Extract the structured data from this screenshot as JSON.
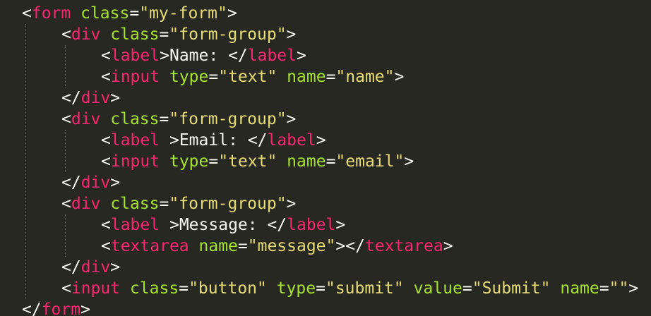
{
  "editor": {
    "colors": {
      "background": "#272822",
      "tag": "#f92672",
      "attribute": "#a6e22e",
      "string": "#e6db74",
      "text": "#f8f8f2",
      "indent_guide": "#5a5a52"
    },
    "lines": [
      {
        "tokens": [
          [
            "punc",
            "<"
          ],
          [
            "tag",
            "form"
          ],
          [
            "text",
            " "
          ],
          [
            "attr",
            "class"
          ],
          [
            "punc",
            "="
          ],
          [
            "str",
            "\"my-form\""
          ],
          [
            "punc",
            ">"
          ]
        ]
      },
      {
        "tokens": [
          [
            "punc",
            "<"
          ],
          [
            "tag",
            "div"
          ],
          [
            "text",
            " "
          ],
          [
            "attr",
            "class"
          ],
          [
            "punc",
            "="
          ],
          [
            "str",
            "\"form-group\""
          ],
          [
            "punc",
            ">"
          ]
        ]
      },
      {
        "tokens": [
          [
            "punc",
            "<"
          ],
          [
            "tag",
            "label"
          ],
          [
            "punc",
            ">"
          ],
          [
            "text",
            "Name: "
          ],
          [
            "punc",
            "</"
          ],
          [
            "tag",
            "label"
          ],
          [
            "punc",
            ">"
          ]
        ]
      },
      {
        "tokens": [
          [
            "punc",
            "<"
          ],
          [
            "tag",
            "input"
          ],
          [
            "text",
            " "
          ],
          [
            "attr",
            "type"
          ],
          [
            "punc",
            "="
          ],
          [
            "str",
            "\"text\""
          ],
          [
            "text",
            " "
          ],
          [
            "attr",
            "name"
          ],
          [
            "punc",
            "="
          ],
          [
            "str",
            "\"name\""
          ],
          [
            "punc",
            ">"
          ]
        ]
      },
      {
        "tokens": [
          [
            "punc",
            "</"
          ],
          [
            "tag",
            "div"
          ],
          [
            "punc",
            ">"
          ]
        ]
      },
      {
        "tokens": [
          [
            "punc",
            "<"
          ],
          [
            "tag",
            "div"
          ],
          [
            "text",
            " "
          ],
          [
            "attr",
            "class"
          ],
          [
            "punc",
            "="
          ],
          [
            "str",
            "\"form-group\""
          ],
          [
            "punc",
            ">"
          ]
        ]
      },
      {
        "tokens": [
          [
            "punc",
            "<"
          ],
          [
            "tag",
            "label"
          ],
          [
            "text",
            " "
          ],
          [
            "punc",
            ">"
          ],
          [
            "text",
            "Email: "
          ],
          [
            "punc",
            "</"
          ],
          [
            "tag",
            "label"
          ],
          [
            "punc",
            ">"
          ]
        ]
      },
      {
        "tokens": [
          [
            "punc",
            "<"
          ],
          [
            "tag",
            "input"
          ],
          [
            "text",
            " "
          ],
          [
            "attr",
            "type"
          ],
          [
            "punc",
            "="
          ],
          [
            "str",
            "\"text\""
          ],
          [
            "text",
            " "
          ],
          [
            "attr",
            "name"
          ],
          [
            "punc",
            "="
          ],
          [
            "str",
            "\"email\""
          ],
          [
            "punc",
            ">"
          ]
        ]
      },
      {
        "tokens": [
          [
            "punc",
            "</"
          ],
          [
            "tag",
            "div"
          ],
          [
            "punc",
            ">"
          ]
        ]
      },
      {
        "tokens": [
          [
            "punc",
            "<"
          ],
          [
            "tag",
            "div"
          ],
          [
            "text",
            " "
          ],
          [
            "attr",
            "class"
          ],
          [
            "punc",
            "="
          ],
          [
            "str",
            "\"form-group\""
          ],
          [
            "punc",
            ">"
          ]
        ]
      },
      {
        "tokens": [
          [
            "punc",
            "<"
          ],
          [
            "tag",
            "label"
          ],
          [
            "text",
            " "
          ],
          [
            "punc",
            ">"
          ],
          [
            "text",
            "Message: "
          ],
          [
            "punc",
            "</"
          ],
          [
            "tag",
            "label"
          ],
          [
            "punc",
            ">"
          ]
        ]
      },
      {
        "tokens": [
          [
            "punc",
            "<"
          ],
          [
            "tag",
            "textarea"
          ],
          [
            "text",
            " "
          ],
          [
            "attr",
            "name"
          ],
          [
            "punc",
            "="
          ],
          [
            "str",
            "\"message\""
          ],
          [
            "punc",
            "></"
          ],
          [
            "tag",
            "textarea"
          ],
          [
            "punc",
            ">"
          ]
        ]
      },
      {
        "tokens": [
          [
            "punc",
            "</"
          ],
          [
            "tag",
            "div"
          ],
          [
            "punc",
            ">"
          ]
        ]
      },
      {
        "tokens": [
          [
            "punc",
            "<"
          ],
          [
            "tag",
            "input"
          ],
          [
            "text",
            " "
          ],
          [
            "attr",
            "class"
          ],
          [
            "punc",
            "="
          ],
          [
            "str",
            "\"button\""
          ],
          [
            "text",
            " "
          ],
          [
            "attr",
            "type"
          ],
          [
            "punc",
            "="
          ],
          [
            "str",
            "\"submit\""
          ],
          [
            "text",
            " "
          ],
          [
            "attr",
            "value"
          ],
          [
            "punc",
            "="
          ],
          [
            "str",
            "\"Submit\""
          ],
          [
            "text",
            " "
          ],
          [
            "attr",
            "name"
          ],
          [
            "punc",
            "="
          ],
          [
            "str",
            "\"\""
          ],
          [
            "punc",
            ">"
          ]
        ]
      },
      {
        "tokens": [
          [
            "punc",
            "</"
          ],
          [
            "tag",
            "form"
          ],
          [
            "punc",
            ">"
          ]
        ]
      }
    ]
  }
}
